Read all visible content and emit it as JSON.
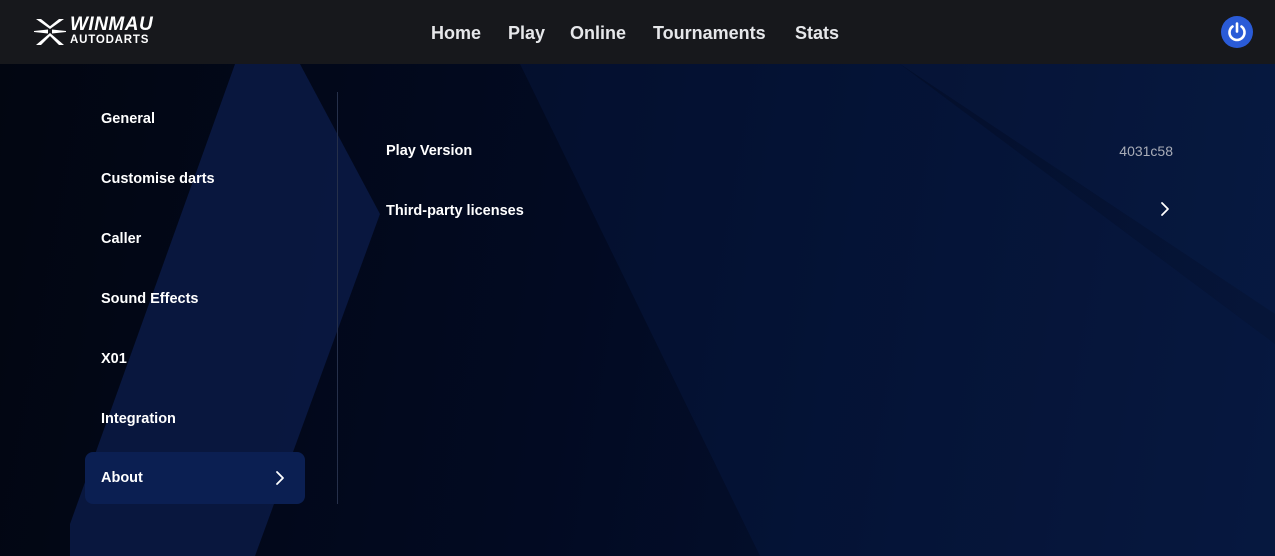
{
  "brand": {
    "name": "WINMAU",
    "subtitle": "AUTODARTS",
    "logo_icon": "star-dart-logo-icon"
  },
  "nav": {
    "items": [
      {
        "label": "Home"
      },
      {
        "label": "Play"
      },
      {
        "label": "Online"
      },
      {
        "label": "Tournaments"
      },
      {
        "label": "Stats"
      }
    ]
  },
  "header": {
    "power_icon": "power-icon",
    "power_color": "#2a5bd7"
  },
  "sidebar": {
    "items": [
      {
        "label": "General"
      },
      {
        "label": "Customise darts"
      },
      {
        "label": "Caller"
      },
      {
        "label": "Sound Effects"
      },
      {
        "label": "X01"
      },
      {
        "label": "Integration"
      },
      {
        "label": "About",
        "active": true
      }
    ],
    "active_color": "#0b1f52"
  },
  "about": {
    "version_label": "Play Version",
    "version_value": "4031c58",
    "licenses_label": "Third-party licenses"
  }
}
